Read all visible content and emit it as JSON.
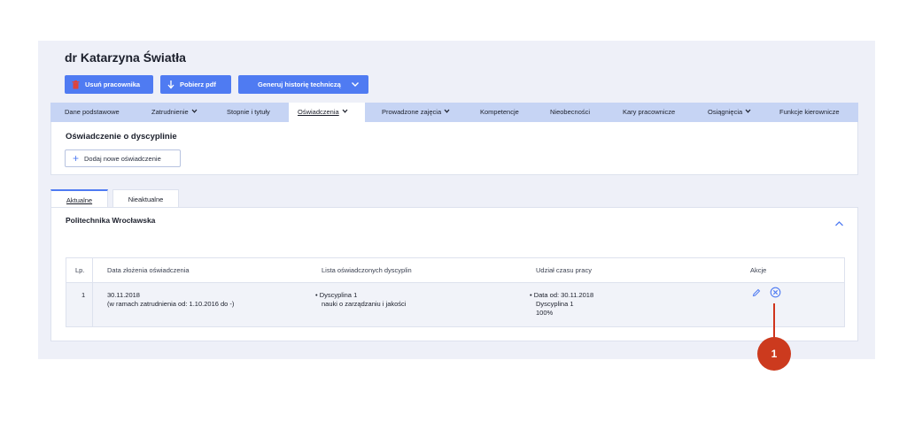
{
  "header": {
    "title": "dr Katarzyna Światła"
  },
  "actions": {
    "delete_label": "Usuń pracownika",
    "pdf_label": "Pobierz pdf",
    "generate_label": "Generuj historię techniczą"
  },
  "tabs": [
    {
      "label": "Dane podstawowe"
    },
    {
      "label": "Zatrudnienie"
    },
    {
      "label": "Stopnie i tytuły"
    },
    {
      "label": "Oświadczenia"
    },
    {
      "label": "Prowadzone zajęcia"
    },
    {
      "label": "Kompetencje"
    },
    {
      "label": "Nieobecności"
    },
    {
      "label": "Kary pracownicze"
    },
    {
      "label": "Osiągnięcia"
    },
    {
      "label": "Funkcje kierownicze"
    }
  ],
  "discipline": {
    "title": "Oświadczenie o dyscyplinie",
    "add_label": "Dodaj nowe oświadczenie"
  },
  "subtabs": {
    "current": "Aktualne",
    "inactive": "Nieaktualne"
  },
  "section": {
    "university": "Politechnika Wrocławska"
  },
  "table": {
    "headers": [
      "Lp.",
      "Data złożenia oświadczenia",
      "Lista oświadczonych dyscyplin",
      "Udział czasu pracy",
      "Akcje"
    ],
    "rows": [
      {
        "lp": "1",
        "date": "30.11.2018",
        "employment": "(w ramach zatrudnienia od: 1.10.2016 do -)",
        "discipline_name": "Dyscyplina 1",
        "discipline_field": "nauki o zarządzaniu i jakości",
        "work_date": "Data od: 30.11.2018",
        "work_discipline": "Dyscyplina 1",
        "work_percent": "100%"
      }
    ]
  },
  "callout": {
    "number": "1"
  },
  "colors": {
    "accent": "#4f7bf2",
    "tabbar": "#c6d4f4",
    "callout": "#cc3a1e"
  }
}
